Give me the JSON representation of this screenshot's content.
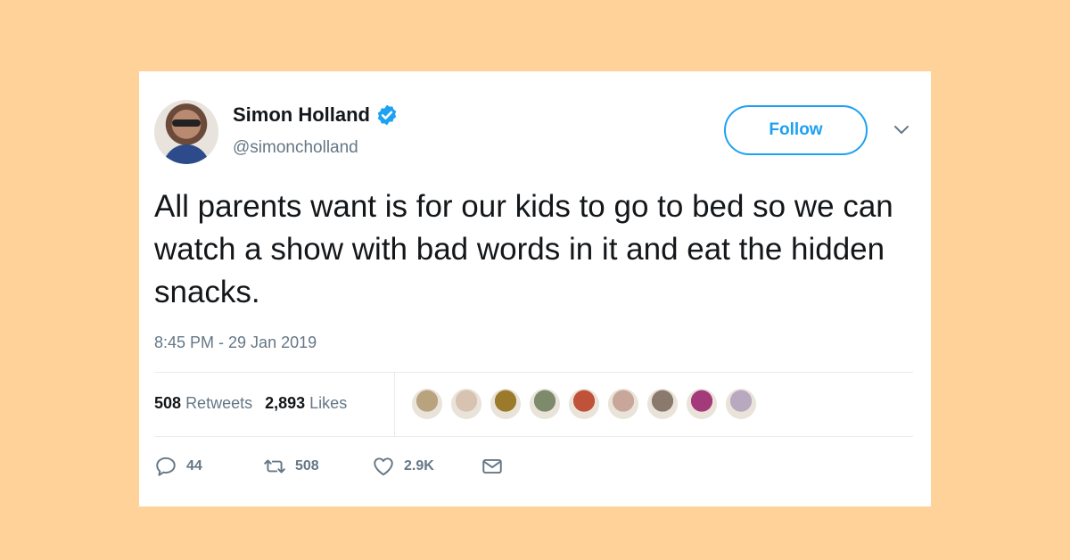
{
  "tweet": {
    "author": {
      "name": "Simon Holland",
      "handle": "@simoncholland",
      "verified": true
    },
    "follow_label": "Follow",
    "text": "All parents want is for our kids to go to bed so we can watch a show with bad words in it and eat the hidden snacks.",
    "timestamp": "8:45 PM - 29 Jan 2019",
    "stats": {
      "retweets_count": "508",
      "retweets_label": "Retweets",
      "likes_count": "2,893",
      "likes_label": "Likes"
    },
    "liker_avatar_colors": [
      "#b9a27e",
      "#d8c2b0",
      "#9c7a2c",
      "#7d8a6b",
      "#c0523a",
      "#c8a79a",
      "#8a7a6e",
      "#a33a7a",
      "#b8a8c0"
    ],
    "actions": {
      "reply_count": "44",
      "retweet_count": "508",
      "like_count": "2.9K"
    }
  },
  "colors": {
    "background": "#FED298",
    "accent": "#1da1f2",
    "muted": "#657786"
  },
  "icons": {
    "verified": "verified-badge-icon",
    "caret": "chevron-down-icon",
    "reply": "reply-icon",
    "retweet": "retweet-icon",
    "like": "heart-icon",
    "dm": "envelope-icon"
  }
}
